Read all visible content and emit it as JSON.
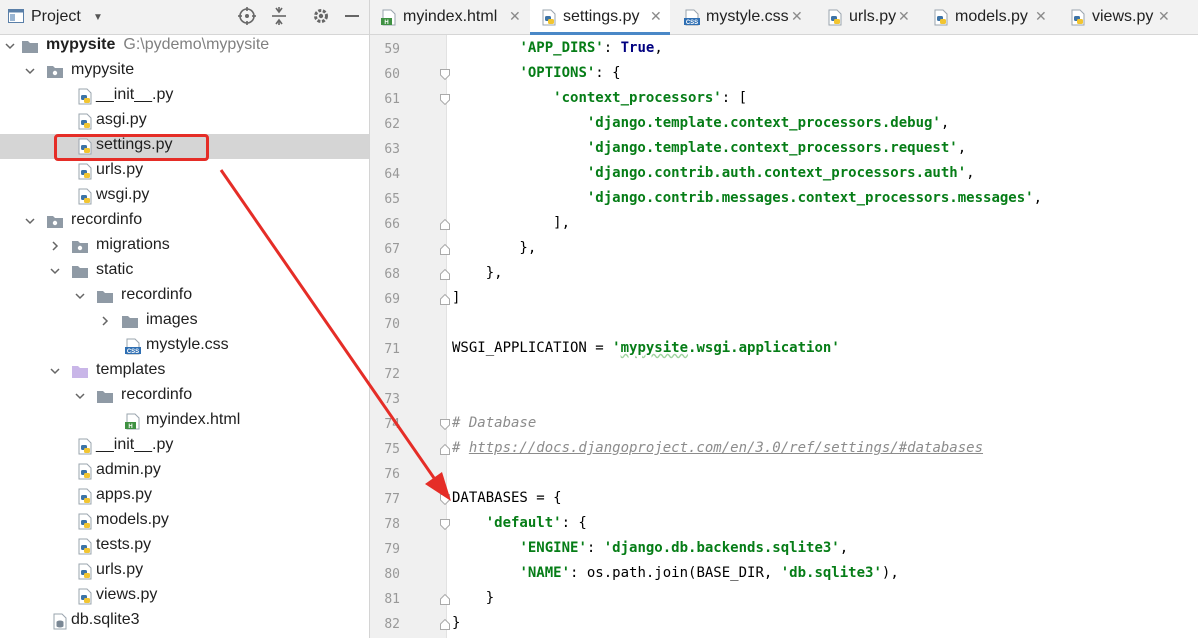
{
  "project_panel": {
    "title": "Project",
    "tree": [
      {
        "label": "mypysite",
        "path": "G:\\pydemo\\mypysite"
      },
      {
        "label": "mypysite"
      },
      {
        "label": "__init__.py"
      },
      {
        "label": "asgi.py"
      },
      {
        "label": "settings.py",
        "selected": true
      },
      {
        "label": "urls.py"
      },
      {
        "label": "wsgi.py"
      },
      {
        "label": "recordinfo"
      },
      {
        "label": "migrations"
      },
      {
        "label": "static"
      },
      {
        "label": "recordinfo"
      },
      {
        "label": "images"
      },
      {
        "label": "mystyle.css"
      },
      {
        "label": "templates"
      },
      {
        "label": "recordinfo"
      },
      {
        "label": "myindex.html"
      },
      {
        "label": "__init__.py"
      },
      {
        "label": "admin.py"
      },
      {
        "label": "apps.py"
      },
      {
        "label": "models.py"
      },
      {
        "label": "tests.py"
      },
      {
        "label": "urls.py"
      },
      {
        "label": "views.py"
      },
      {
        "label": "db.sqlite3"
      }
    ]
  },
  "tabs": [
    {
      "label": "myindex.html",
      "icon": "html-file-icon"
    },
    {
      "label": "settings.py",
      "icon": "python-file-icon",
      "active": true
    },
    {
      "label": "mystyle.css",
      "icon": "css-file-icon"
    },
    {
      "label": "urls.py",
      "icon": "python-file-icon"
    },
    {
      "label": "models.py",
      "icon": "python-file-icon"
    },
    {
      "label": "views.py",
      "icon": "python-file-icon"
    }
  ],
  "editor": {
    "lines": [
      {
        "n": "59",
        "t": "        'APP_DIRS': True,"
      },
      {
        "n": "60",
        "t": "        'OPTIONS': {"
      },
      {
        "n": "61",
        "t": "            'context_processors': ["
      },
      {
        "n": "62",
        "t": "                'django.template.context_processors.debug',"
      },
      {
        "n": "63",
        "t": "                'django.template.context_processors.request',"
      },
      {
        "n": "64",
        "t": "                'django.contrib.auth.context_processors.auth',"
      },
      {
        "n": "65",
        "t": "                'django.contrib.messages.context_processors.messages',"
      },
      {
        "n": "66",
        "t": "            ],"
      },
      {
        "n": "67",
        "t": "        },"
      },
      {
        "n": "68",
        "t": "    },"
      },
      {
        "n": "69",
        "t": "]"
      },
      {
        "n": "70",
        "t": ""
      },
      {
        "n": "71",
        "t": "WSGI_APPLICATION = 'mypysite.wsgi.application'"
      },
      {
        "n": "72",
        "t": ""
      },
      {
        "n": "73",
        "t": ""
      },
      {
        "n": "74",
        "t": "# Database"
      },
      {
        "n": "75",
        "t": "# https://docs.djangoproject.com/en/3.0/ref/settings/#databases"
      },
      {
        "n": "76",
        "t": ""
      },
      {
        "n": "77",
        "t": "DATABASES = {"
      },
      {
        "n": "78",
        "t": "    'default': {"
      },
      {
        "n": "79",
        "t": "        'ENGINE': 'django.db.backends.sqlite3',"
      },
      {
        "n": "80",
        "t": "        'NAME': os.path.join(BASE_DIR, 'db.sqlite3'),"
      },
      {
        "n": "81",
        "t": "    }"
      },
      {
        "n": "82",
        "t": "}"
      }
    ]
  },
  "colors": {
    "string": "#067d17",
    "keyword": "#000080",
    "comment": "#8c8c8c",
    "highlight": "#e52d27",
    "active_tab": "#4a88c7"
  }
}
